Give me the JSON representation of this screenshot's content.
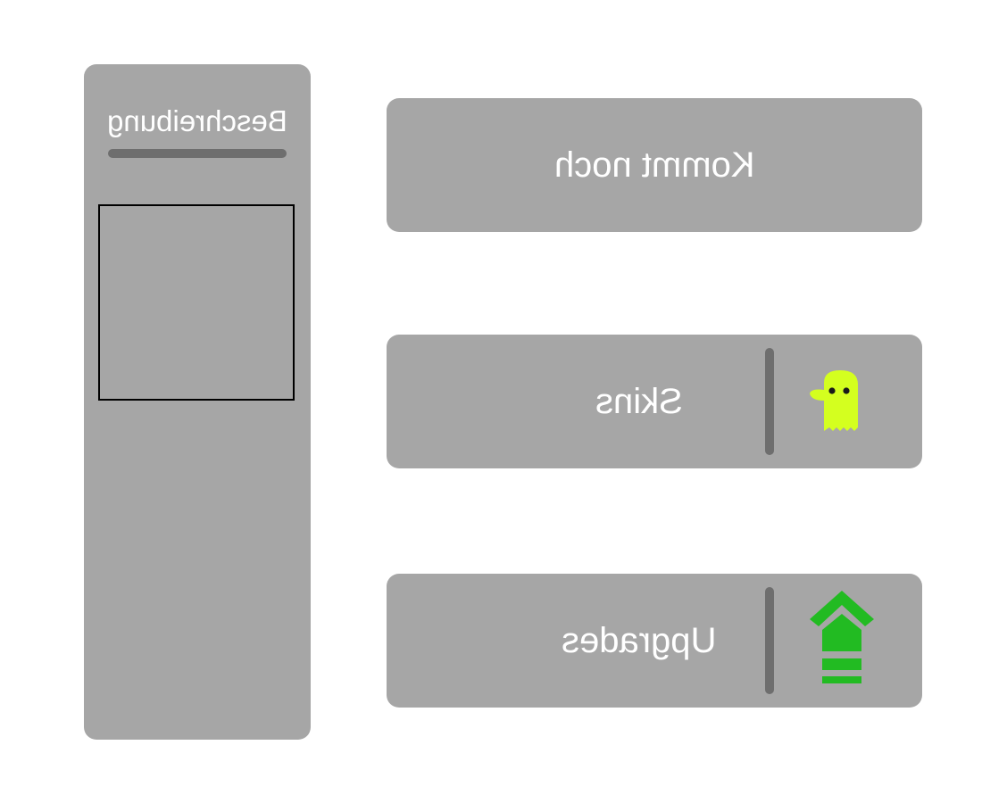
{
  "description_panel": {
    "title": "Beschreibung"
  },
  "menu": {
    "coming_label": "Kommt noch",
    "skins_label": "Skins",
    "upgrades_label": "Upgrades"
  },
  "icons": {
    "skins": "ghost-icon",
    "upgrades": "upgrade-arrow-icon"
  },
  "colors": {
    "panel": "#a6a6a6",
    "divider": "#6e6e6e",
    "ghost": "#d4ff1f",
    "upgrade": "#22bb22",
    "text": "#ffffff"
  }
}
